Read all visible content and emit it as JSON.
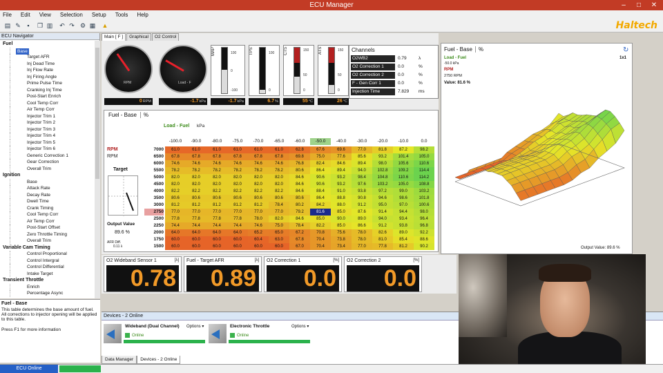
{
  "window": {
    "title": "ECU Manager"
  },
  "menu": [
    "File",
    "Edit",
    "View",
    "Selection",
    "Setup",
    "Tools",
    "Help"
  ],
  "logo": "Haltech",
  "nav": {
    "header": "ECU Navigator",
    "groups": [
      {
        "name": "Fuel",
        "items": [
          "Base",
          "Target AFR",
          "Inj Dead Time",
          "Inj Flow Rate",
          "Inj Firing Angle",
          "Prime Pulse Time",
          "Cranking Inj Time",
          "Post-Start Enrich",
          "Cool Temp Corr",
          "Air Temp Corr",
          "Injector Trim 1",
          "Injector Trim 2",
          "Injector Trim 3",
          "Injector Trim 4",
          "Injector Trim 5",
          "Injector Trim 6",
          "Generic Correction 1",
          "Gear Correction",
          "Overall Trim"
        ]
      },
      {
        "name": "Ignition",
        "items": [
          "Base",
          "Attack Rate",
          "Decay Rate",
          "Dwell Time",
          "Crank Timing",
          "Cool Temp Corr",
          "Air Temp Corr",
          "Post-Start Offset",
          "Zero Throttle Timing",
          "Overall Trim"
        ]
      },
      {
        "name": "Variable Cam Timing",
        "items": [
          "Control Proportional",
          "Control Intergral",
          "Control Differential",
          "Intake Target"
        ]
      },
      {
        "name": "Transient Throttle",
        "items": [
          "Enrich",
          "Percentage Async"
        ]
      }
    ]
  },
  "desc": {
    "title": "Fuel - Base",
    "text": "This table determines the base amount of fuel. All corrections to injector opening will be applied to this table.",
    "help": "Press F1 for more information"
  },
  "status": {
    "online": "ECU Online"
  },
  "main_tabs": [
    "Main [ F ]",
    "Graphical",
    "O2 Control"
  ],
  "gauges": {
    "rpm": {
      "label": "RPM",
      "value": "0",
      "unit": "RPM"
    },
    "load": {
      "label": "Load - F",
      "value": "-1.7",
      "unit": "kPa"
    },
    "map": {
      "label": "MAP",
      "value": "-1.7",
      "unit": "kPa",
      "s1": "100",
      "s2": "0",
      "s3": "-100"
    },
    "tps": {
      "label": "TPS",
      "value": "6.7",
      "unit": "%",
      "s1": "100",
      "s2": "0"
    },
    "cts": {
      "label": "CTS",
      "value": "55",
      "unit": "°C",
      "s1": "150",
      "s2": "50",
      "s3": "0"
    },
    "ats": {
      "label": "ATS",
      "value": "26",
      "unit": "°C",
      "s1": "150",
      "s2": "50",
      "s3": "0"
    }
  },
  "channels": {
    "title": "Channels",
    "rows": [
      {
        "name": "O2WB2",
        "value": "0.79",
        "unit": "λ"
      },
      {
        "name": "O2 Correction 1",
        "value": "0.0",
        "unit": "%"
      },
      {
        "name": "O2 Correction 2",
        "value": "0.0",
        "unit": "%"
      },
      {
        "name": "F - Gen Corr 1",
        "value": "0.0",
        "unit": "%"
      },
      {
        "name": "Injection Time",
        "value": "7.829",
        "unit": "ms"
      }
    ]
  },
  "fuel_table": {
    "title": "Fuel - Base",
    "pct": "%",
    "load_label": "Load - Fuel",
    "load_unit": "kPa",
    "rpm_label": "RPM",
    "rpm_label2": "RPM",
    "target_label": "Target",
    "output_label": "Output Value",
    "output_value": "89.6 %",
    "afr_label": "AFR Diff.",
    "afr_val": "0.11 λ",
    "cols": [
      "-100.0",
      "-90.0",
      "-80.0",
      "-75.0",
      "-70.0",
      "-65.0",
      "-60.0",
      "-50.0",
      "-40.0",
      "-30.0",
      "-20.0",
      "-10.0",
      "0.0"
    ],
    "rows": [
      "7000",
      "6500",
      "6000",
      "5500",
      "5000",
      "4500",
      "4000",
      "3500",
      "3000",
      "2750",
      "2500",
      "2250",
      "2000",
      "1750",
      "1500"
    ],
    "data": [
      [
        "61.0",
        "61.0",
        "61.0",
        "61.0",
        "61.0",
        "61.0",
        "62.8",
        "67.6",
        "69.6",
        "77.0",
        "81.8",
        "87.2",
        "98.2"
      ],
      [
        "67.8",
        "67.8",
        "67.8",
        "67.8",
        "67.8",
        "67.8",
        "69.8",
        "75.0",
        "77.6",
        "85.6",
        "93.2",
        "101.4",
        "105.0"
      ],
      [
        "74.6",
        "74.6",
        "74.6",
        "74.6",
        "74.6",
        "74.6",
        "76.8",
        "82.4",
        "84.6",
        "89.4",
        "98.0",
        "105.6",
        "110.6"
      ],
      [
        "78.2",
        "78.2",
        "78.2",
        "78.2",
        "78.2",
        "78.2",
        "80.6",
        "86.4",
        "89.4",
        "94.0",
        "102.8",
        "109.2",
        "114.4"
      ],
      [
        "82.0",
        "82.0",
        "82.0",
        "82.0",
        "82.0",
        "82.0",
        "84.6",
        "90.6",
        "93.2",
        "98.4",
        "104.8",
        "110.6",
        "114.2"
      ],
      [
        "82.0",
        "82.0",
        "82.0",
        "82.0",
        "82.0",
        "82.0",
        "84.6",
        "90.6",
        "93.2",
        "97.6",
        "103.2",
        "105.0",
        "108.8"
      ],
      [
        "82.2",
        "82.2",
        "82.2",
        "82.2",
        "82.2",
        "82.2",
        "84.6",
        "88.4",
        "91.0",
        "93.8",
        "97.2",
        "99.0",
        "103.2"
      ],
      [
        "80.6",
        "80.6",
        "80.6",
        "80.6",
        "80.6",
        "80.6",
        "80.6",
        "86.4",
        "88.8",
        "90.8",
        "94.6",
        "98.6",
        "101.8"
      ],
      [
        "81.2",
        "81.2",
        "81.2",
        "81.2",
        "81.2",
        "78.4",
        "80.2",
        "84.2",
        "88.0",
        "91.2",
        "95.0",
        "97.0",
        "100.6"
      ],
      [
        "77.0",
        "77.0",
        "77.0",
        "77.0",
        "77.0",
        "77.0",
        "79.2",
        "81.6",
        "85.0",
        "87.6",
        "91.4",
        "94.4",
        "98.0"
      ],
      [
        "77.8",
        "77.8",
        "77.8",
        "77.8",
        "78.0",
        "82.0",
        "84.6",
        "85.0",
        "90.0",
        "89.0",
        "94.0",
        "93.4",
        "96.4"
      ],
      [
        "74.4",
        "74.4",
        "74.4",
        "74.4",
        "74.6",
        "75.0",
        "78.4",
        "82.2",
        "85.0",
        "86.6",
        "91.2",
        "93.8",
        "96.8"
      ],
      [
        "64.0",
        "64.0",
        "64.0",
        "64.0",
        "65.2",
        "65.0",
        "67.2",
        "70.8",
        "75.6",
        "78.0",
        "82.6",
        "89.0",
        "92.2"
      ],
      [
        "60.0",
        "60.0",
        "60.0",
        "60.0",
        "60.4",
        "63.0",
        "67.8",
        "70.4",
        "73.8",
        "78.0",
        "81.0",
        "85.4",
        "88.6"
      ],
      [
        "60.0",
        "60.0",
        "60.0",
        "60.0",
        "60.0",
        "60.0",
        "67.0",
        "70.4",
        "73.4",
        "77.0",
        "77.8",
        "81.2",
        "90.2"
      ]
    ],
    "active_row": "2750",
    "active_col": "-50.0",
    "selected_cell": "81.6"
  },
  "view3d": {
    "title": "Fuel - Base",
    "pct": "%",
    "load": "Load - Fuel",
    "load_val": "-50.0 kPa",
    "rpm": "RPM",
    "rpm_val": "2750 RPM",
    "value": "Value: 81.6 %",
    "zoom": "1x1",
    "output": "Output Value: 89.6 %"
  },
  "panels": [
    {
      "title": "O2 Wideband Sensor 1",
      "unit": "[λ]",
      "value": "0.78"
    },
    {
      "title": "Fuel - Target AFR",
      "unit": "[λ]",
      "value": "0.89"
    },
    {
      "title": "O2 Correction 1",
      "unit": "[%]",
      "value": "0.0"
    },
    {
      "title": "O2 Correction 2",
      "unit": "[%]",
      "value": "0.0"
    }
  ],
  "devices": {
    "header": "Devices - 2 Online",
    "items": [
      {
        "name": "Wideband (Dual Channel)",
        "options": "Options ▾",
        "status": "Online"
      },
      {
        "name": "Electronic Throttle",
        "options": "Options ▾",
        "status": "Online"
      }
    ],
    "tabs": [
      "Data Manager",
      "Devices - 2 Online"
    ]
  }
}
